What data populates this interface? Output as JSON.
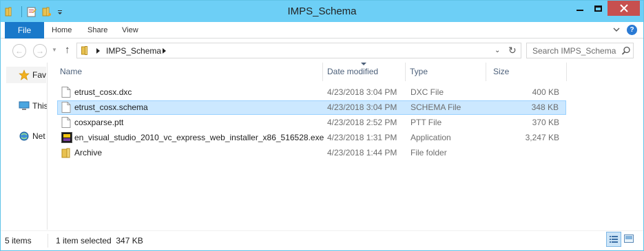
{
  "window": {
    "title": "IMPS_Schema"
  },
  "ribbon": {
    "tabs": {
      "file": "File",
      "home": "Home",
      "share": "Share",
      "view": "View"
    },
    "help": "?"
  },
  "address": {
    "crumb": "IMPS_Schema"
  },
  "search": {
    "placeholder": "Search IMPS_Schema"
  },
  "nav_pane": {
    "favorites": "Fav",
    "this_pc": "This",
    "network": "Net"
  },
  "columns": {
    "name": "Name",
    "date": "Date modified",
    "type": "Type",
    "size": "Size"
  },
  "files": [
    {
      "name": "etrust_cosx.dxc",
      "date": "4/23/2018 3:04 PM",
      "type": "DXC File",
      "size": "400 KB",
      "icon": "document-icon",
      "selected": false
    },
    {
      "name": "etrust_cosx.schema",
      "date": "4/23/2018 3:04 PM",
      "type": "SCHEMA File",
      "size": "348 KB",
      "icon": "document-icon",
      "selected": true
    },
    {
      "name": "cosxparse.ptt",
      "date": "4/23/2018 2:52 PM",
      "type": "PTT File",
      "size": "370 KB",
      "icon": "document-icon",
      "selected": false
    },
    {
      "name": "en_visual_studio_2010_vc_express_web_installer_x86_516528.exe",
      "date": "4/23/2018 1:31 PM",
      "type": "Application",
      "size": "3,247 KB",
      "icon": "installer-icon",
      "selected": false
    },
    {
      "name": "Archive",
      "date": "4/23/2018 1:44 PM",
      "type": "File folder",
      "size": "",
      "icon": "folder-icon",
      "selected": false
    }
  ],
  "status": {
    "item_count": "5 items",
    "selection": "1 item selected  347 KB"
  },
  "colors": {
    "titlebar": "#6dcff6",
    "file_tab": "#1979ca",
    "selection": "#cce8ff",
    "close_button": "#c7504f"
  }
}
